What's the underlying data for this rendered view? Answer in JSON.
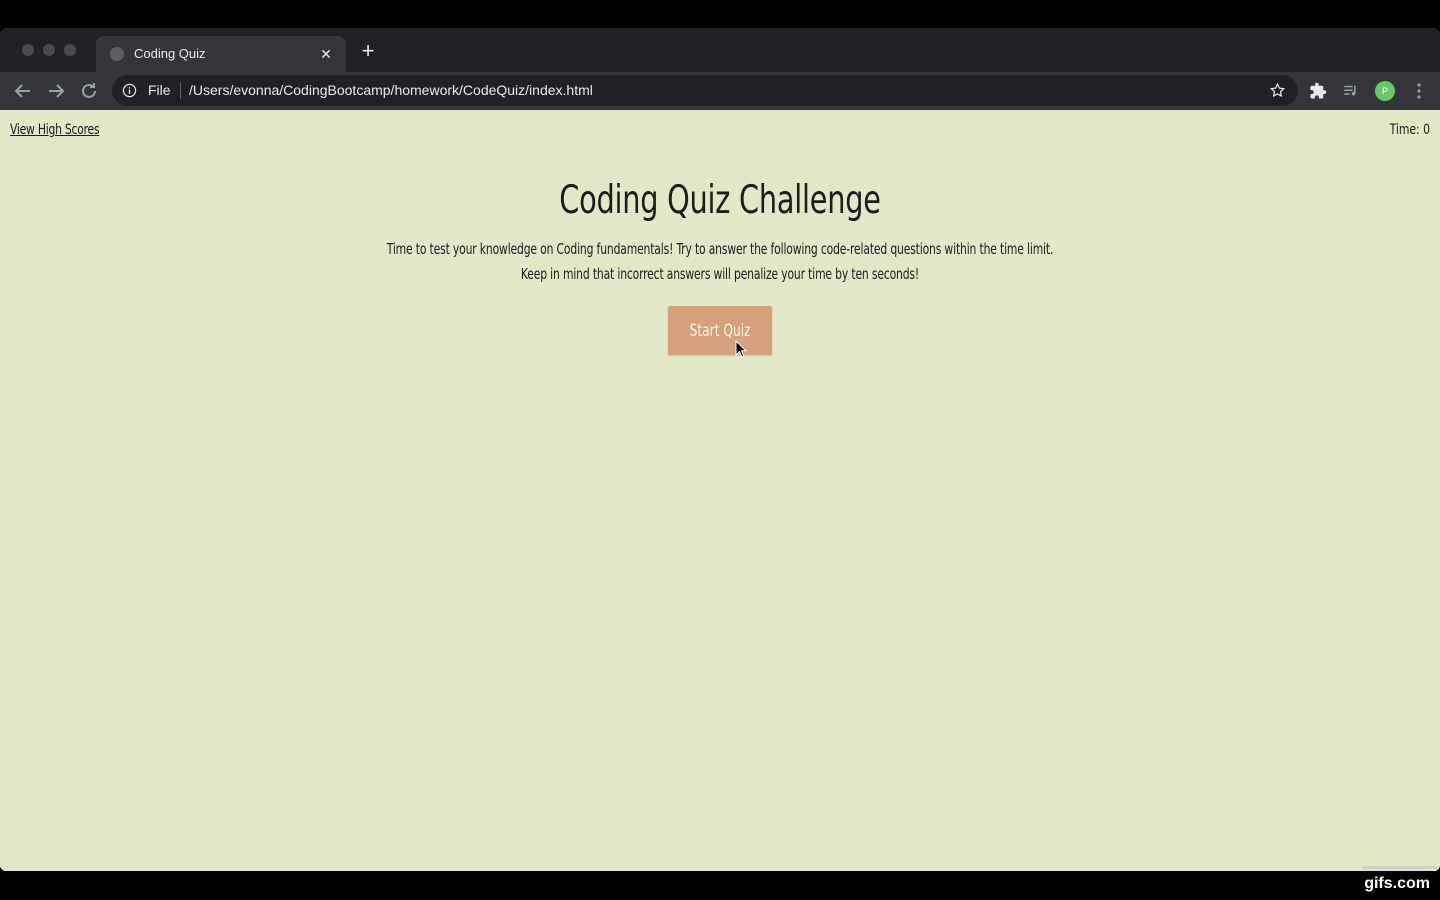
{
  "browser": {
    "tab_title": "Coding Quiz",
    "file_label": "File",
    "url": "/Users/evonna/CodingBootcamp/homework/CodeQuiz/index.html",
    "avatar_initial": "P"
  },
  "header": {
    "high_scores_link": "View High Scores",
    "timer": "Time: 0"
  },
  "main": {
    "title": "Coding Quiz Challenge",
    "description_line1": "Time to test your knowledge on Coding fundamentals! Try to answer the following code-related questions within the time limit.",
    "description_line2": "Keep in mind that incorrect answers will penalize your time by ten seconds!",
    "start_button": "Start Quiz"
  },
  "watermark": "gifs.com",
  "colors": {
    "page_background": "#e2e8c7",
    "button_background": "#d4a17a",
    "button_text": "#fdf4ea",
    "chrome_dark": "#202124",
    "chrome_toolbar": "#35363a"
  }
}
